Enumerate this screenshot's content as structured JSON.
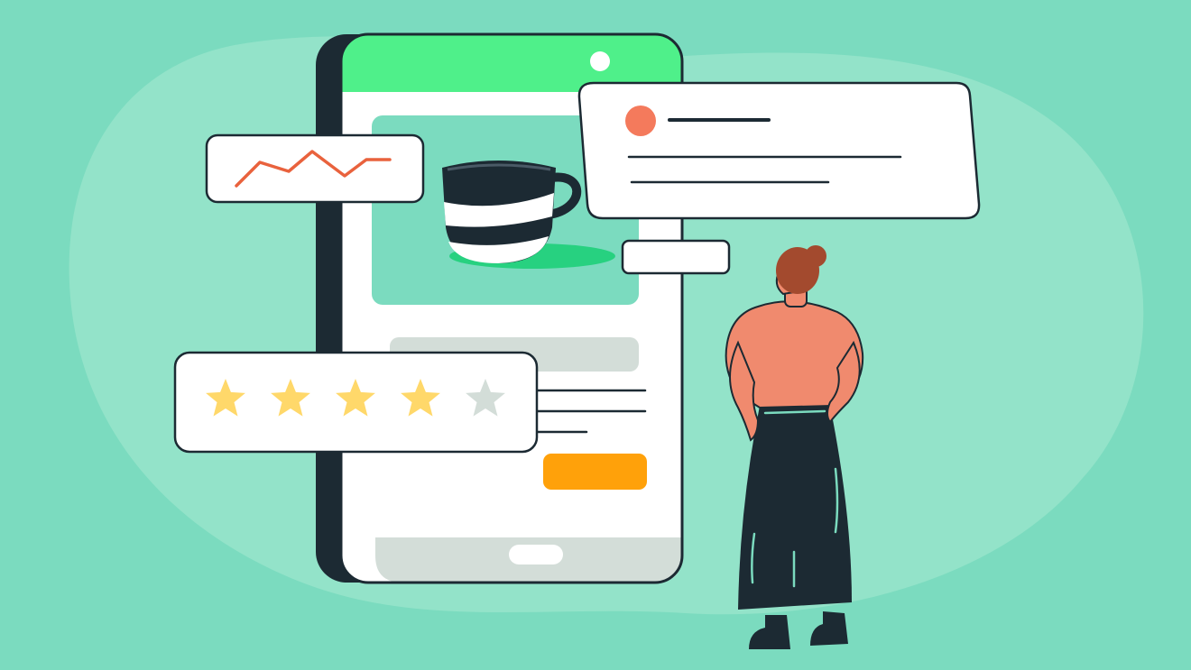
{
  "colors": {
    "background": "#7BDBBF",
    "blob": "#93E3C9",
    "outline": "#1C2A33",
    "phone_header": "#4FF08A",
    "phone_screen": "#FFFFFF",
    "phone_bezel": "#1C2A33",
    "product_card": "#7BDBBF",
    "saucer": "#27D180",
    "placeholder_bar": "#D3DDD8",
    "cta_button": "#FFA10A",
    "home_bar": "#D3DDD8",
    "chart_line": "#E9623D",
    "avatar": "#F47A5C",
    "star_filled": "#FFD86A",
    "star_empty": "#D3DDD8",
    "skin": "#F08A6E",
    "hair": "#A34A2E",
    "skirt": "#1C2A33",
    "skirt_stitch": "#7BDBBF"
  },
  "icons": {
    "mug": "coffee-mug-icon",
    "trend": "trend-line-icon",
    "avatar": "user-avatar-icon",
    "star": "star-icon"
  },
  "rating": {
    "value": 4,
    "max": 5
  }
}
